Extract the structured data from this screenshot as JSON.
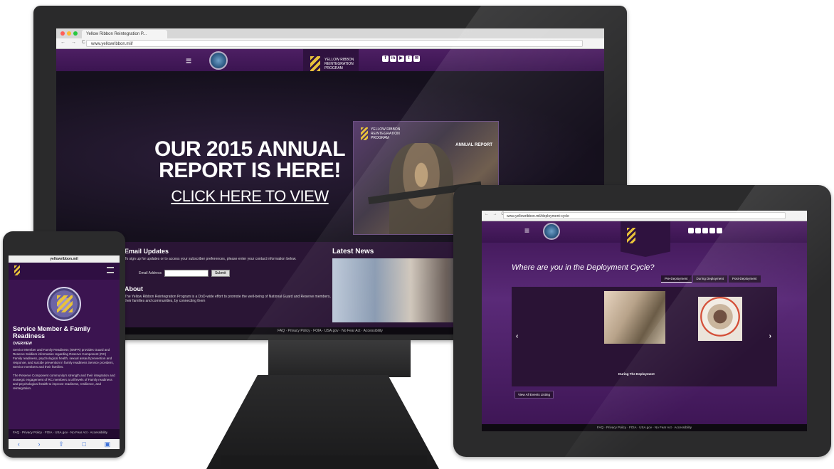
{
  "monitor": {
    "browser_tab": "Yellow Ribbon Reintegration P...",
    "browser_nav": "← → C",
    "address": "www.yellowribbon.mil/",
    "header": {
      "menu_glyph": "≡",
      "logo_text": "YELLOW RIBBON REINTEGRATION PROGRAM",
      "social_icons": [
        "f",
        "in",
        "▶",
        "t",
        "✉"
      ]
    },
    "hero": {
      "title": "OUR 2015 ANNUAL REPORT IS HERE!",
      "cta": "CLICK HERE TO VIEW",
      "report_title": "ANNUAL REPORT",
      "report_program": "YELLOW RIBBON REINTEGRATION PROGRAM"
    },
    "email_updates": {
      "heading": "Email Updates",
      "description": "To sign up for updates or to access your subscriber preferences, please enter your contact information below.",
      "email_label": "Email Address",
      "submit_label": "Submit"
    },
    "about": {
      "heading": "About",
      "description": "The Yellow Ribbon Reintegration Program is a DoD-wide effort to promote the well-being of National Guard and Reserve members, their families and communities, by connecting them"
    },
    "latest_news": {
      "heading": "Latest News"
    },
    "footer": "FAQ · Privacy Policy · FOIA · USA.gov · No Fear Act · Accessibility"
  },
  "phone": {
    "address": "yellowribbon.mil",
    "title": "Service Member & Family Readiness",
    "subtitle": "OVERVIEW",
    "body1": "Service Member and Family Readiness (SMFR) provides Guard and Reserve Soldiers information regarding Reserve Component (RC) Family readiness, psychological health, sexual assault prevention and response, and suicide prevention in family readiness Service providers, Service members and their families.",
    "body2": "The Reserve Component community's strength and their integration and strategic engagement of RC members at all levels of Family readiness and psychological health to improve readiness, resilience, and reintegration.",
    "footer": "FAQ · Privacy Policy · FOIA · USA.gov · No Fear Act · Accessibility",
    "toolbar": [
      "‹",
      "›",
      "⇧",
      "□",
      "▣"
    ]
  },
  "tablet": {
    "browser_nav": "← → C",
    "address": "www.yellowribbon.mil/deployment-cycle",
    "menu_glyph": "≡",
    "question": "Where are you in the Deployment Cycle?",
    "tabs": [
      "Pre-Deployment",
      "During Deployment",
      "Post-Deployment"
    ],
    "carousel_prev": "‹",
    "carousel_next": "›",
    "caption": "During The Deployment",
    "view_all": "View All Events Listing",
    "footer": "FAQ · Privacy Policy · FOIA · USA.gov · No Fear Act · Accessibility"
  }
}
